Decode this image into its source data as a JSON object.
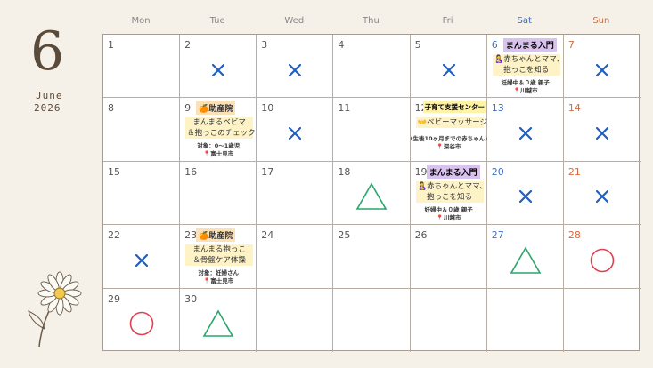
{
  "month": {
    "number": "6",
    "name": "June",
    "year": "2026"
  },
  "weekdays": [
    "Mon",
    "Tue",
    "Wed",
    "Thu",
    "Fri",
    "Sat",
    "Sun"
  ],
  "colors": {
    "x_mark": "#1f5fc2",
    "triangle": "#2aa66b",
    "circle": "#e04050",
    "sat": "#3a6ec6",
    "sun": "#d96a3a"
  },
  "days": {
    "d1": "1",
    "d2": "2",
    "d3": "3",
    "d4": "4",
    "d5": "5",
    "d6": "6",
    "d7": "7",
    "d8": "8",
    "d9": "9",
    "d10": "10",
    "d11": "11",
    "d12": "12",
    "d13": "13",
    "d14": "14",
    "d15": "15",
    "d16": "16",
    "d17": "17",
    "d18": "18",
    "d19": "19",
    "d20": "20",
    "d21": "21",
    "d22": "22",
    "d23": "23",
    "d24": "24",
    "d25": "25",
    "d26": "26",
    "d27": "27",
    "d28": "28",
    "d29": "29",
    "d30": "30"
  },
  "availability_marks": {
    "d2": "x",
    "d3": "x",
    "d5": "x",
    "d7": "x",
    "d10": "x",
    "d13": "x",
    "d14": "x",
    "d18": "triangle",
    "d20": "x",
    "d21": "x",
    "d22": "x",
    "d27": "triangle",
    "d28": "circle",
    "d29": "circle",
    "d30": "triangle"
  },
  "events": {
    "d6": {
      "title": "まんまる入門",
      "line1": "🤱赤ちゃんとママ、",
      "line2": "抱っこを知る",
      "meta1": "妊婦中＆０歳 親子",
      "meta2": "📍川越市"
    },
    "d9": {
      "title": "🍊助産院",
      "line1": "まんまるベビマ",
      "line2": "＆抱っこのチェック",
      "meta1": "対象：0～1歳児",
      "meta2": "📍富士見市"
    },
    "d12": {
      "title": "子育て支援センター",
      "line1": "👐ベビーマッサージ",
      "meta1": "(生後10ヶ月までの赤ちゃん)",
      "meta2": "📍深谷市"
    },
    "d19": {
      "title": "まんまる入門",
      "line1": "🤱赤ちゃんとママ、",
      "line2": "抱っこを知る",
      "meta1": "妊婦中＆０歳 親子",
      "meta2": "📍川越市"
    },
    "d23": {
      "title": "🍊助産院",
      "line1": "まんまる抱っこ",
      "line2": "＆骨盤ケア体操",
      "meta1": "対象：妊婦さん",
      "meta2": "📍富士見市"
    }
  }
}
